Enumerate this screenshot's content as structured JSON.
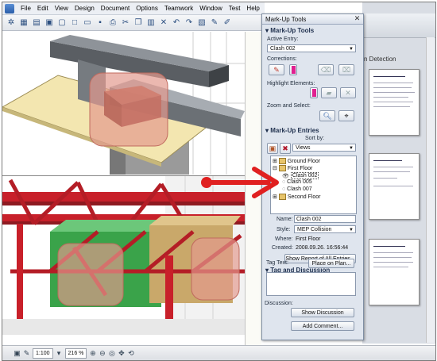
{
  "menu": {
    "items": [
      "File",
      "Edit",
      "View",
      "Design",
      "Document",
      "Options",
      "Teamwork",
      "Window",
      "Test",
      "Help"
    ]
  },
  "palette": {
    "title": "Mark-Up Tools",
    "section_markup_tools": "Mark-Up Tools",
    "active_entry_label": "Active Entry:",
    "active_entry_value": "Clash 002",
    "corrections_label": "Corrections:",
    "highlight_label": "Highlight Elements:",
    "zoom_label": "Zoom and Select:",
    "section_entries": "Mark-Up Entries",
    "sort_by_label": "Sort by:",
    "sort_by_value": "Views",
    "tree": {
      "items": [
        {
          "label": "Ground Floor"
        },
        {
          "label": "First Floor"
        },
        {
          "label": "Clash 002"
        },
        {
          "label": "Clash 005"
        },
        {
          "label": "Clash 007"
        },
        {
          "label": "Second Floor"
        }
      ]
    },
    "name_label": "Name:",
    "name_value": "Clash 002",
    "style_label": "Style:",
    "style_value": "MEP Collision",
    "where_label": "Where:",
    "where_value": "First Floor",
    "created_label": "Created:",
    "created_value": "2008.09.26. 16:56:44",
    "report_button": "Show Report of All Entries...",
    "section_tag": "Tag and Discussion",
    "tag_text_label": "Tag Text:",
    "place_on_plan_button": "Place on Plan...",
    "discussion_label": "Discussion:",
    "show_discussion_button": "Show Discussion",
    "add_comment_button": "Add Comment..."
  },
  "document": {
    "title": "n Detection"
  },
  "statusbar": {
    "scale": "1:100",
    "zoom": "216 %"
  },
  "colors": {
    "clash_highlight": "#e39a8e",
    "arrow": "#e02020",
    "palette_bg": "#dfe5ee",
    "steel_red": "#c8202a",
    "duct_green": "#3aa34a"
  }
}
